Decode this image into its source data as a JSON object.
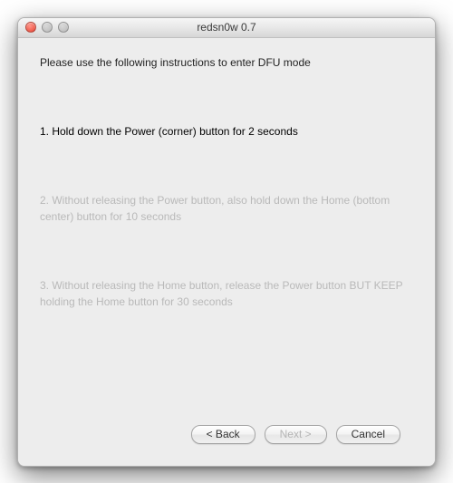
{
  "window": {
    "title": "redsn0w 0.7"
  },
  "content": {
    "intro": "Please use the following instructions to enter DFU mode",
    "steps": {
      "s1": "1. Hold down the Power (corner) button for 2 seconds",
      "s2": "2. Without releasing the Power button, also hold down the Home (bottom center) button for 10 seconds",
      "s3": "3. Without releasing the Home button, release the Power button BUT KEEP holding the Home button for 30 seconds"
    }
  },
  "buttons": {
    "back": "< Back",
    "next": "Next >",
    "cancel": "Cancel"
  }
}
